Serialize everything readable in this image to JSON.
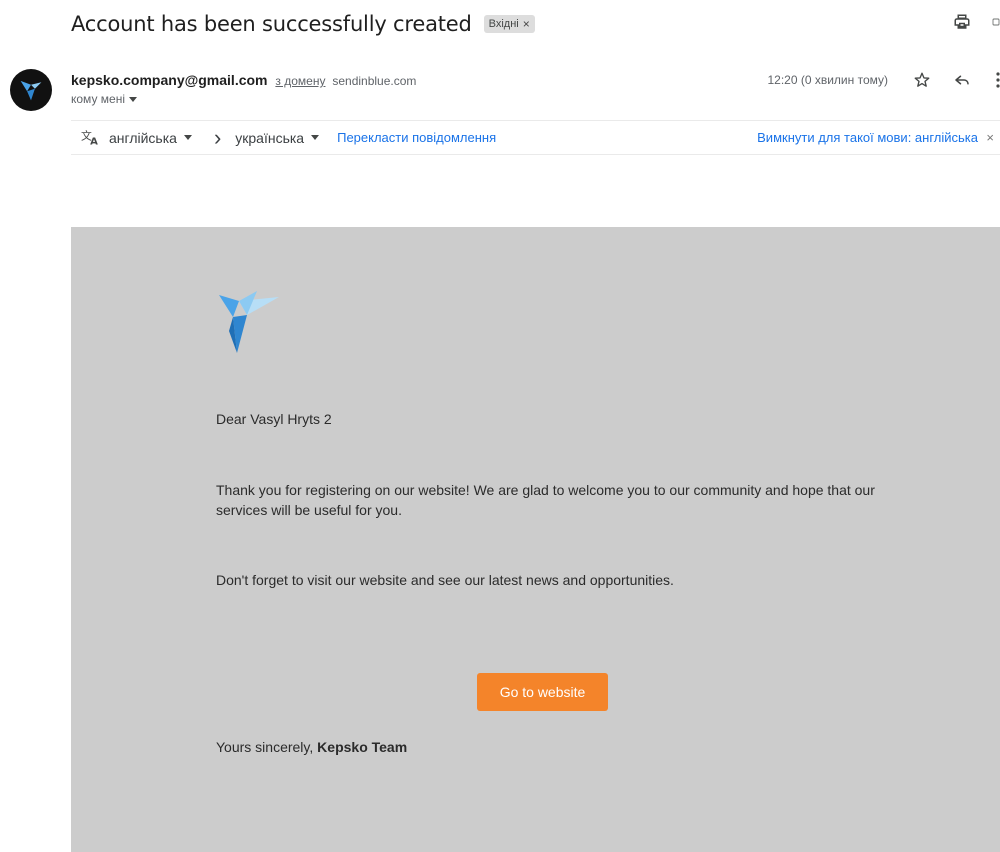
{
  "email": {
    "subject": "Account has been successfully created",
    "label": "Вхідні",
    "label_close": "×"
  },
  "sender": {
    "email": "kepsko.company@gmail.com",
    "via_text": "з домену",
    "via_domain": "sendinblue.com",
    "recipient": "кому мені",
    "time": "12:20 (0 хвилин тому)"
  },
  "translate_bar": {
    "source_lang": "англійська",
    "arrow": "›",
    "target_lang": "українська",
    "translate_link": "Перекласти повідомлення",
    "disable_link": "Вимкнути для такої мови: англійська",
    "close": "×"
  },
  "body": {
    "greeting": "Dear Vasyl Hryts 2",
    "paragraph1": "Thank you for registering on our website! We are glad to welcome you to our community and hope that our services will be useful for you.",
    "paragraph2": "Don't forget to visit our website and see our latest news and opportunities.",
    "cta_label": "Go to website",
    "signoff_prefix": "Yours sincerely, ",
    "signoff_team": "Kepsko Team"
  },
  "icons": {
    "print": "print-icon",
    "open_new_window": "open-in-new-window-icon",
    "star": "star-icon",
    "reply": "reply-icon",
    "more": "more-vert-icon",
    "translate": "translate-icon",
    "logo": "bird-logo-icon"
  },
  "colors": {
    "body_background": "#cccccc",
    "cta_background": "#f4842a",
    "link": "#1a73e8",
    "avatar": "#111111"
  }
}
